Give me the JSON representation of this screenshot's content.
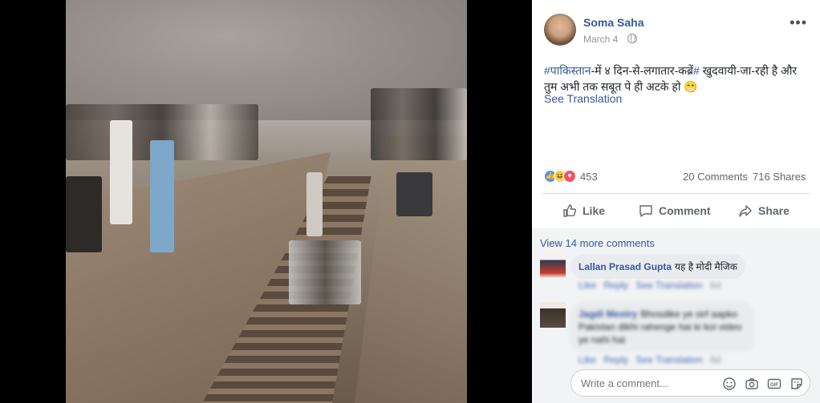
{
  "post": {
    "author": "Soma Saha",
    "date": "March 4",
    "privacy_icon": "globe-icon",
    "text_hashtag1": "#पाकिस्तान",
    "text_part1": "-में ४ दिन-से-लगातार-कब्रें",
    "text_hashtag2": "#",
    "text_part2": " खुदवायी-जा-रही है और तुम अभी तक सबूत पे ही अटके हो 😁",
    "see_translation": "See Translation"
  },
  "stats": {
    "reaction_count": "453",
    "comments": "20 Comments",
    "shares": "716 Shares"
  },
  "actions": {
    "like": "Like",
    "comment": "Comment",
    "share": "Share"
  },
  "comments": {
    "view_more": "View 14 more comments",
    "items": [
      {
        "name": "Lallan Prasad Gupta",
        "text": "यह है मोदी मैजिक",
        "like": "Like",
        "reply": "Reply",
        "translation": "See Translation",
        "time": "6d"
      },
      {
        "name": "Jagdi Mestry",
        "text": "Bhosdike ye sirf aapko Pakistan dikhi rahenge hai ki koi video ye nahi hai",
        "like": "Like",
        "reply": "Reply",
        "translation": "See Translation",
        "time": "6d"
      }
    ],
    "write_placeholder": "Write a comment..."
  },
  "colors": {
    "link": "#365899",
    "muted": "#606770",
    "like": "#5890ff",
    "love": "#f25268",
    "haha": "#fcd669"
  }
}
